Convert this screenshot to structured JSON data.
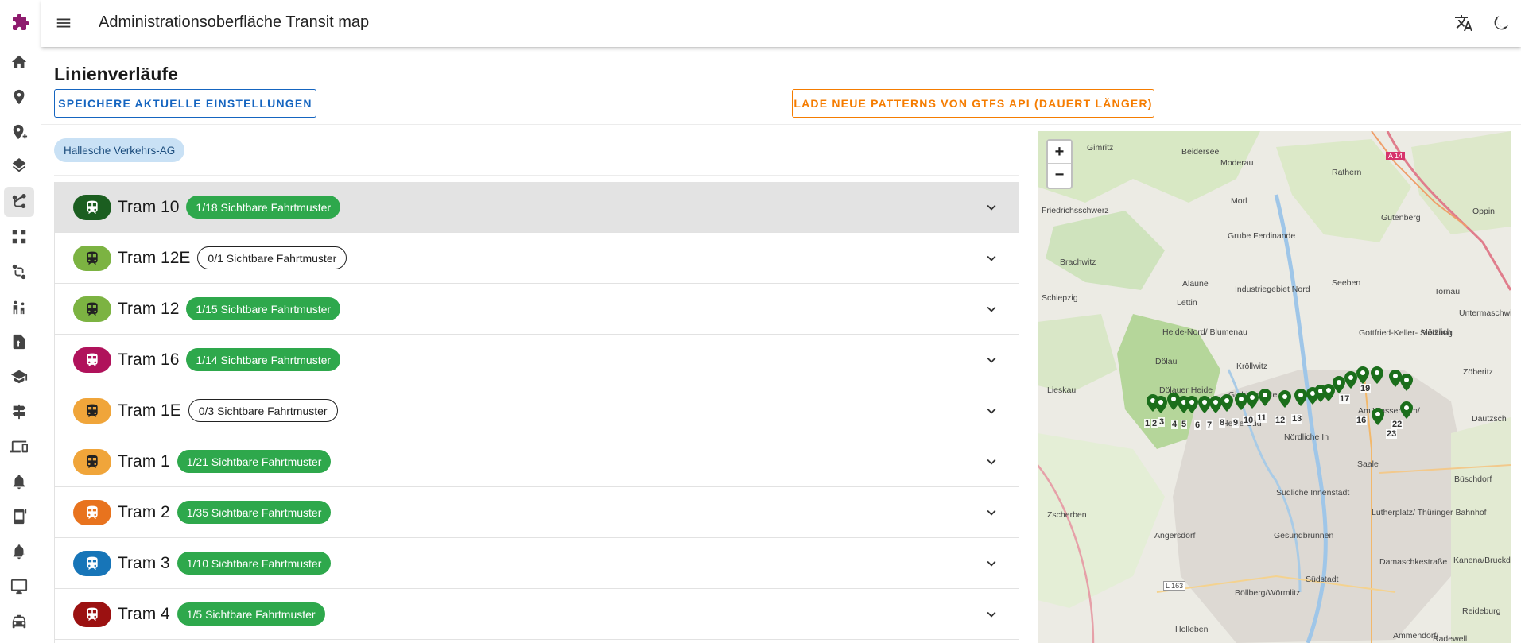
{
  "app": {
    "title": "Administrationsoberfläche Transit map"
  },
  "sidebar": {
    "items": [
      {
        "icon": "home-icon"
      },
      {
        "icon": "location-pin-icon"
      },
      {
        "icon": "add-location-icon"
      },
      {
        "icon": "layers-icon"
      },
      {
        "icon": "route-icon",
        "active": true
      },
      {
        "icon": "network-icon"
      },
      {
        "icon": "stops-route-icon"
      },
      {
        "icon": "passengers-icon"
      },
      {
        "icon": "upload-file-icon"
      },
      {
        "icon": "school-icon"
      },
      {
        "icon": "signpost-icon"
      },
      {
        "icon": "devices-icon"
      },
      {
        "icon": "alarm-icon"
      },
      {
        "icon": "display-device-icon"
      },
      {
        "icon": "notification-settings-icon"
      },
      {
        "icon": "monitor-icon"
      },
      {
        "icon": "taxi-icon"
      }
    ]
  },
  "header": {
    "page_title": "Linienverläufe",
    "save_button": "Speichere aktuelle Einstellungen",
    "load_button": "Lade neue Patterns von GTFS API (dauert länger)"
  },
  "agency_chip": "Hallesche Verkehrs-AG",
  "routes": [
    {
      "name": "Tram 10",
      "badge": "1/18 Sichtbare Fahrtmuster",
      "color": "#1b5e20",
      "visible": true,
      "selected": true
    },
    {
      "name": "Tram 12E",
      "badge": "0/1 Sichtbare Fahrtmuster",
      "color": "#7cb342",
      "visible": false
    },
    {
      "name": "Tram 12",
      "badge": "1/15 Sichtbare Fahrtmuster",
      "color": "#7cb342",
      "visible": true
    },
    {
      "name": "Tram 16",
      "badge": "1/14 Sichtbare Fahrtmuster",
      "color": "#b0125b",
      "visible": true
    },
    {
      "name": "Tram 1E",
      "badge": "0/3 Sichtbare Fahrtmuster",
      "color": "#f0a53a",
      "visible": false
    },
    {
      "name": "Tram 1",
      "badge": "1/21 Sichtbare Fahrtmuster",
      "color": "#f0a53a",
      "visible": true
    },
    {
      "name": "Tram 2",
      "badge": "1/35 Sichtbare Fahrtmuster",
      "color": "#e8731e",
      "visible": true
    },
    {
      "name": "Tram 3",
      "badge": "1/10 Sichtbare Fahrtmuster",
      "color": "#1775b8",
      "visible": true
    },
    {
      "name": "Tram 4",
      "badge": "1/5 Sichtbare Fahrtmuster",
      "color": "#9b1111",
      "visible": true
    }
  ],
  "map": {
    "zoom_in": "+",
    "zoom_out": "−",
    "labels": [
      "Gimritz",
      "Beidersee",
      "Moderau",
      "Rathern",
      "A 14",
      "Friedrichsschwerz",
      "Morl",
      "Gutenberg",
      "Grube Ferdinande",
      "Oppin",
      "Brachwitz",
      "Alaune",
      "Industriegebiet Nord",
      "Seeben",
      "Tornau",
      "Untermaschwitz",
      "Schiepzig",
      "Lettin",
      "Heide-Nord/ Blumenau",
      "Gottfried-Keller- Siedlung",
      "Mötzlich",
      "Dölau",
      "Kröllwitz",
      "Zöberitz",
      "Lieskau",
      "Dölauer Heide",
      "Giebichenstein",
      "Am Wasserturm/",
      "Heide-Süd",
      "Nördliche In",
      "Dautzsch",
      "Zscherben",
      "Südliche Innenstadt",
      "Lutherplatz/ Thüringer Bahnhof",
      "Büschdorf",
      "Angersdorf",
      "Gesundbrunnen",
      "Damaschkestraße",
      "Kanena/Bruckdorf",
      "Südstadt",
      "L 163",
      "Böllberg/Wörmlitz",
      "Reideburg",
      "Holleben",
      "Ammendorf/",
      "Radewell",
      "Saale"
    ],
    "stop_numbers": [
      "1",
      "2",
      "3",
      "4",
      "5",
      "6",
      "7",
      "8",
      "9",
      "10",
      "11",
      "12",
      "13",
      "16",
      "17",
      "19",
      "22",
      "23"
    ]
  }
}
